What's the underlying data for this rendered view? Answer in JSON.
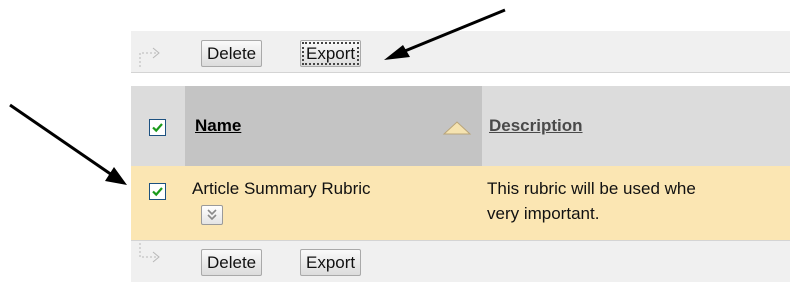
{
  "toolbar_top": {
    "delete_label": "Delete",
    "export_label": "Export"
  },
  "table": {
    "columns": {
      "name": "Name",
      "description": "Description"
    },
    "rows": [
      {
        "name": "Article Summary Rubric",
        "description_line1": "This rubric will be used whe",
        "description_line2": "very important.",
        "checked": true
      }
    ],
    "select_all_checked": true
  },
  "toolbar_bottom": {
    "delete_label": "Delete",
    "export_label": "Export"
  },
  "colors": {
    "accent": "#1c5180",
    "row_highlight": "#fbe6b3",
    "sort_arrow": "#f5e3b0"
  },
  "icons": {
    "hook": "hook-arrow-icon",
    "sort": "sort-ascending-icon",
    "menu": "chevron-down-icon",
    "check": "checkmark-icon"
  }
}
